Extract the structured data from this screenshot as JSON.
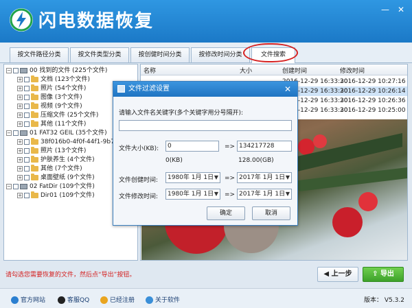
{
  "app": {
    "title": "闪电数据恢复",
    "minimize": "—",
    "close": "✕"
  },
  "tabs": [
    {
      "label": "按文件路径分类"
    },
    {
      "label": "按文件类型分类"
    },
    {
      "label": "按创健时间分类"
    },
    {
      "label": "按修改时间分类"
    },
    {
      "label": "文件搜索"
    }
  ],
  "tree": [
    {
      "label": "00  找到的文件  (225个文件)"
    },
    {
      "label": "文档   (123个文件)"
    },
    {
      "label": "照片   (54个文件)"
    },
    {
      "label": "图像   (3个文件)"
    },
    {
      "label": "视频   (9个文件)"
    },
    {
      "label": "压缩文件   (25个文件)"
    },
    {
      "label": "其他   (11个文件)"
    },
    {
      "label": "01  FAT32  GEIL   (35个文件)"
    },
    {
      "label": "38f016b0-4f0f-44f1-9b79-2"
    },
    {
      "label": "照片   (13个文件)"
    },
    {
      "label": "护肤养生   (4个文件)"
    },
    {
      "label": "其他   (7个文件)"
    },
    {
      "label": "桌面壁纸   (9个文件)"
    },
    {
      "label": "02  FatDir   (109个文件)"
    },
    {
      "label": "Dir01   (109个文件)"
    }
  ],
  "filelist": {
    "columns": [
      "名称",
      "大小",
      "创建时间",
      "修改时间"
    ],
    "rows": [
      {
        "created": "2016-12-29  16:33:30",
        "modified": "2016-12-29  10:27:16"
      },
      {
        "created": "2016-12-29  16:33:30",
        "modified": "2016-12-29  10:26:14"
      },
      {
        "created": "2016-12-29  16:33:30",
        "modified": "2016-12-29  10:26:36"
      },
      {
        "created": "2016-12-29  16:33:30",
        "modified": "2016-12-29  10:25:00"
      }
    ]
  },
  "dialog": {
    "title": "文件过滤设置",
    "close": "✕",
    "keyword_prompt": "请输入文件名关键字(多个关键字用分号隔开):",
    "keyword_value": "",
    "size_label": "文件大小(KB):",
    "size_min": "0",
    "arrow": "=>",
    "size_max": "134217728",
    "size_min_hint": "0(KB)",
    "size_max_hint": "128.00(GB)",
    "created_label": "文件创健时间:",
    "created_from": "1980年  1月  1日",
    "created_to": "2017年  1月  1日",
    "modified_label": "文件修改时间:",
    "modified_from": "1980年  1月  1日",
    "modified_to": "2017年  1月  1日",
    "ok": "确定",
    "cancel": "取消"
  },
  "bottom": {
    "hint": "请勾选您需要恢复的文件，然后点“导出”按钮。",
    "prev": "上一步",
    "export": "导出"
  },
  "footer": {
    "links": [
      "官方网站",
      "客服QQ",
      "已经注册",
      "关于软件"
    ],
    "version": "版本：  V5.3.2"
  },
  "colors": {
    "titlebar": "#1b79c7",
    "hint": "#d42020",
    "export": "#3da12a",
    "highlight": "#d62020"
  }
}
